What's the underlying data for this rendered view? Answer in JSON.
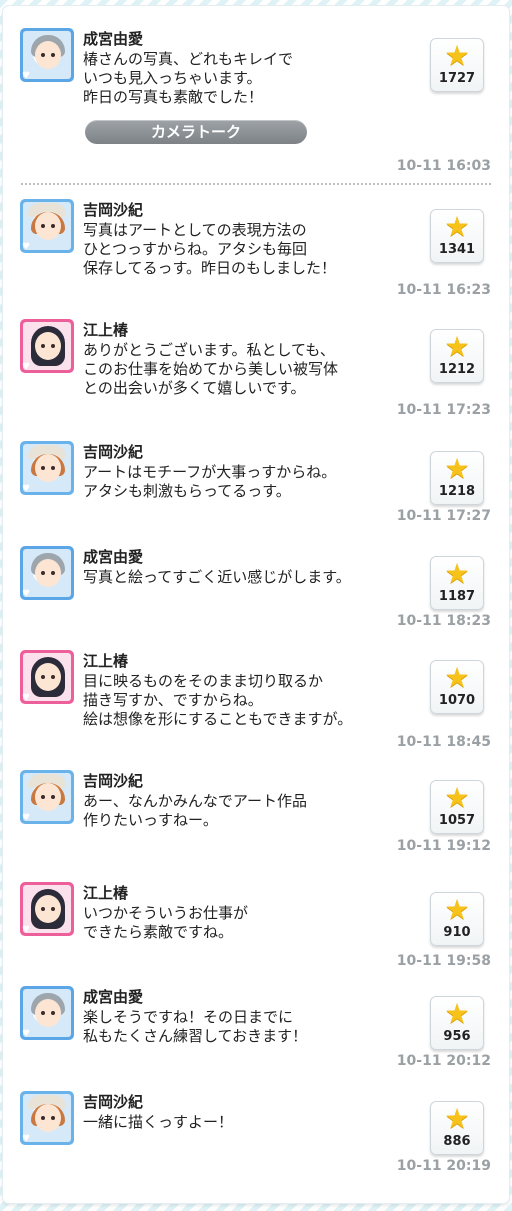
{
  "camera_talk_label": "カメラトーク",
  "colors": {
    "star": "#f7c21a",
    "blue_frame": "#5aa6e6",
    "pink_frame": "#ec5f9a",
    "timestamp": "#9aa0a4"
  },
  "posts": [
    {
      "name": "成宮由愛",
      "avatar": "gray-hair-avatar",
      "message": "椿さんの写真、どれもキレイで\nいつも見入っちゃいます。\n昨日の写真も素敵でした！",
      "stars": "1727",
      "time": "10-11 16:03"
    },
    {
      "name": "吉岡沙紀",
      "avatar": "brown-hair-avatar",
      "message": "写真はアートとしての表現方法の\nひとつっすからね。アタシも毎回\n保存してるっす。昨日のもしました！",
      "stars": "1341",
      "time": "10-11 16:23"
    },
    {
      "name": "江上椿",
      "avatar": "black-hair-avatar",
      "message": "ありがとうございます。私としても、\nこのお仕事を始めてから美しい被写体\nとの出会いが多くて嬉しいです。",
      "stars": "1212",
      "time": "10-11 17:23"
    },
    {
      "name": "吉岡沙紀",
      "avatar": "brown-hair-avatar",
      "message": "アートはモチーフが大事っすからね。\nアタシも刺激もらってるっす。",
      "stars": "1218",
      "time": "10-11 17:27"
    },
    {
      "name": "成宮由愛",
      "avatar": "gray-hair-avatar",
      "message": "写真と絵ってすごく近い感じがします。",
      "stars": "1187",
      "time": "10-11 18:23"
    },
    {
      "name": "江上椿",
      "avatar": "black-hair-avatar",
      "message": "目に映るものをそのまま切り取るか\n描き写すか、ですからね。\n絵は想像を形にすることもできますが。",
      "stars": "1070",
      "time": "10-11 18:45"
    },
    {
      "name": "吉岡沙紀",
      "avatar": "brown-hair-avatar",
      "message": "あー、なんかみんなでアート作品\n作りたいっすねー。",
      "stars": "1057",
      "time": "10-11 19:12"
    },
    {
      "name": "江上椿",
      "avatar": "black-hair-avatar",
      "message": "いつかそういうお仕事が\nできたら素敵ですね。",
      "stars": "910",
      "time": "10-11 19:58"
    },
    {
      "name": "成宮由愛",
      "avatar": "gray-hair-avatar",
      "message": "楽しそうですね！その日までに\n私もたくさん練習しておきます！",
      "stars": "956",
      "time": "10-11 20:12"
    },
    {
      "name": "吉岡沙紀",
      "avatar": "brown-hair-avatar",
      "message": "一緒に描くっすよー！",
      "stars": "886",
      "time": "10-11 20:19"
    }
  ]
}
